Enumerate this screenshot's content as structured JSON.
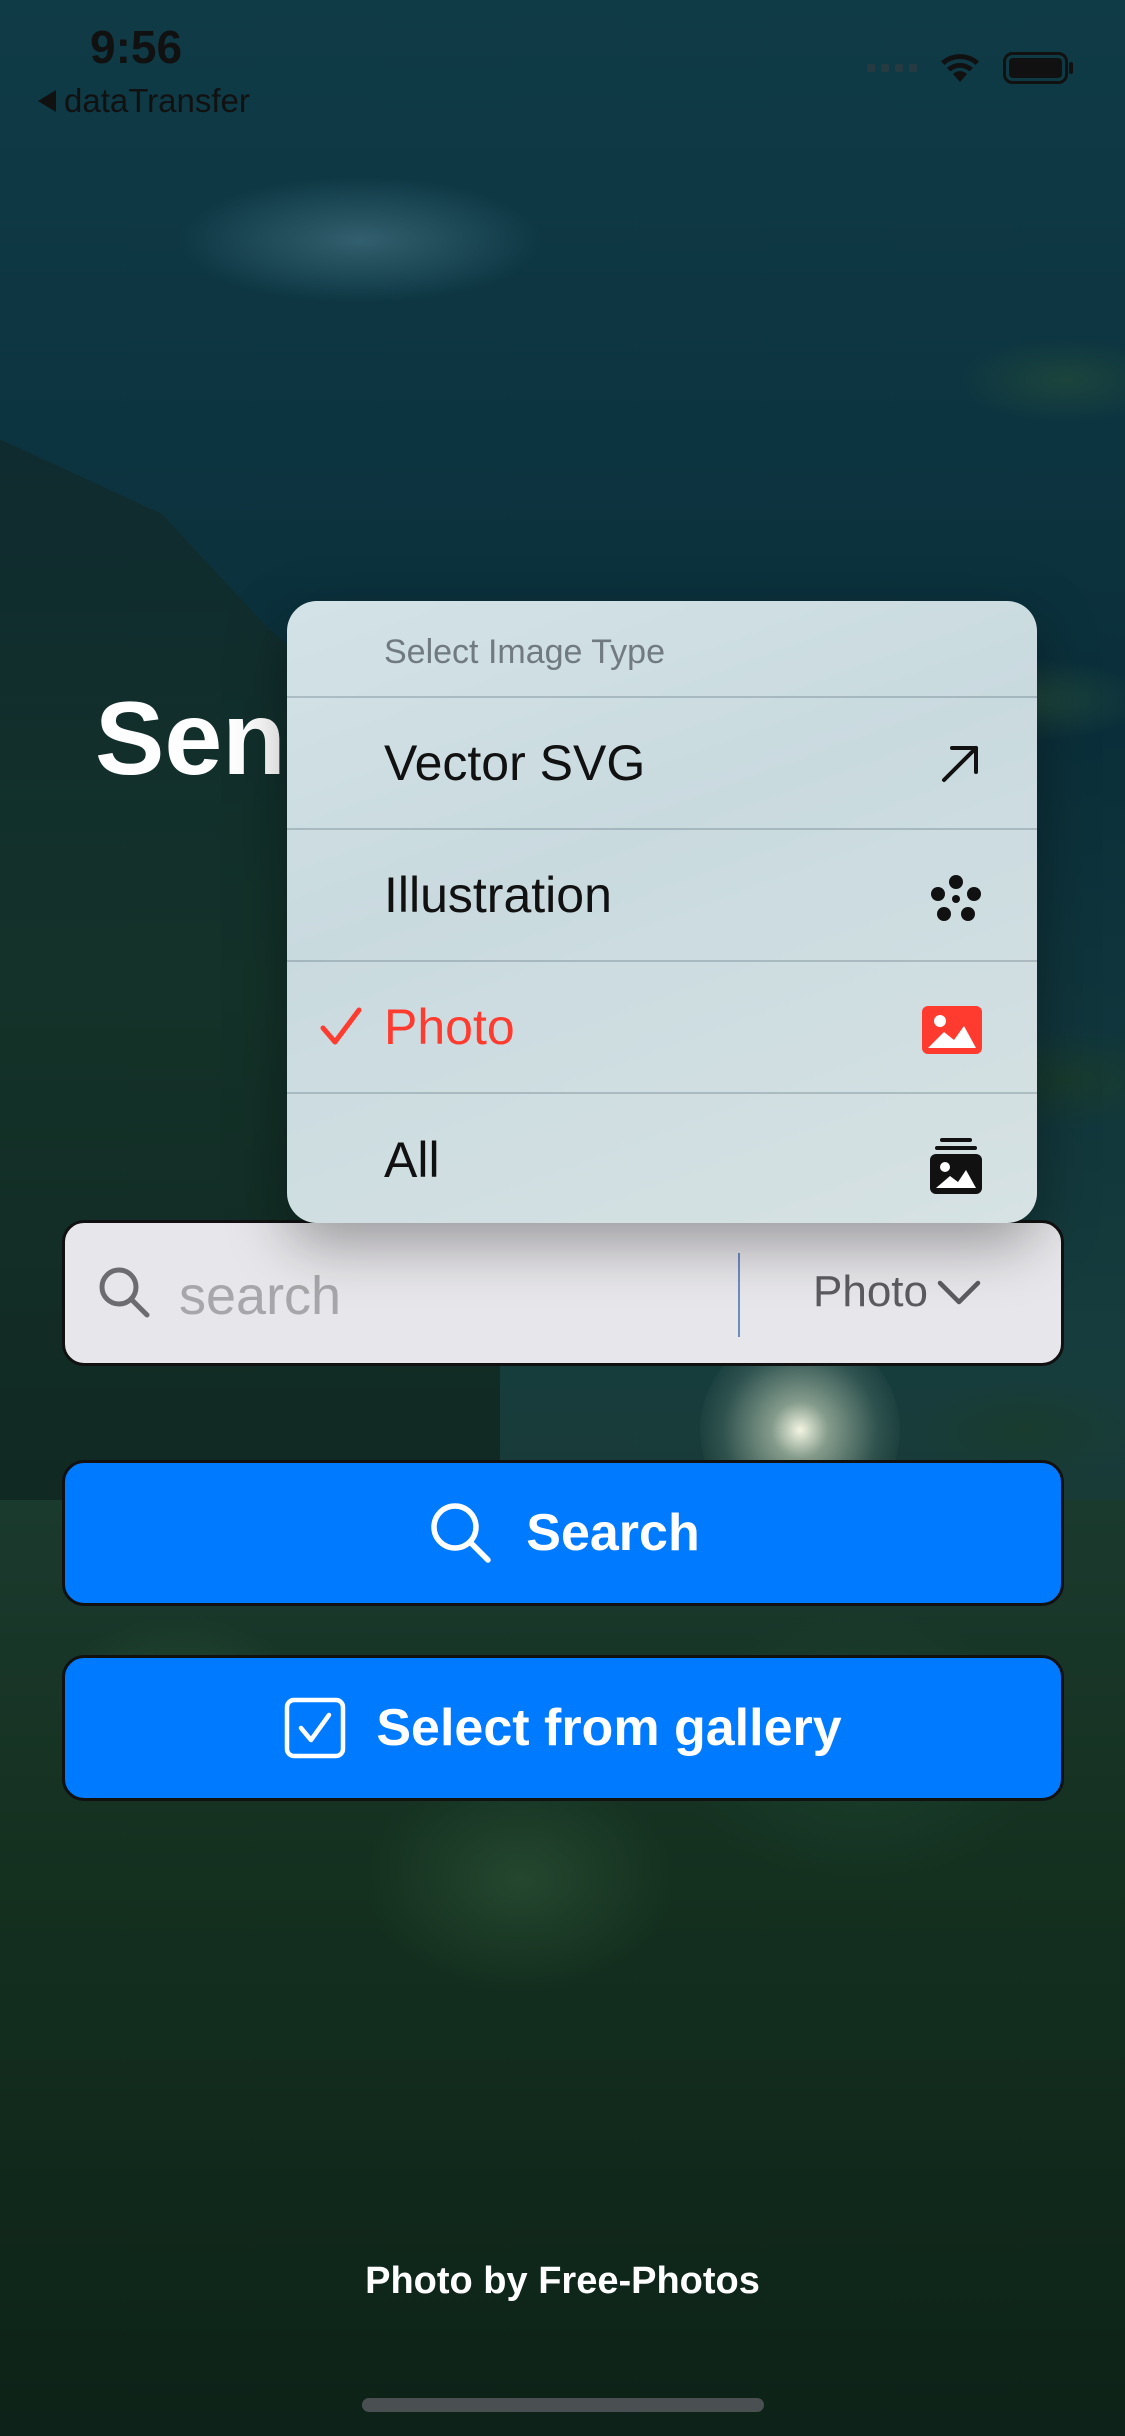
{
  "status_bar": {
    "time": "9:56",
    "back_label": "dataTransfer"
  },
  "page": {
    "title": "Send"
  },
  "type_menu": {
    "header": "Select Image Type",
    "items": [
      {
        "label": "Vector SVG",
        "icon": "arrow-up-right-icon",
        "selected": false
      },
      {
        "label": "Illustration",
        "icon": "dots-cluster-icon",
        "selected": false
      },
      {
        "label": "Photo",
        "icon": "photo-icon",
        "selected": true
      },
      {
        "label": "All",
        "icon": "photo-stack-icon",
        "selected": false
      }
    ]
  },
  "search": {
    "placeholder": "search",
    "type_value": "Photo"
  },
  "buttons": {
    "search_label": "Search",
    "gallery_label": "Select from gallery"
  },
  "footer": {
    "credit": "Photo by Free-Photos"
  },
  "colors": {
    "accent": "#007aff",
    "selected": "#ff3b30"
  }
}
